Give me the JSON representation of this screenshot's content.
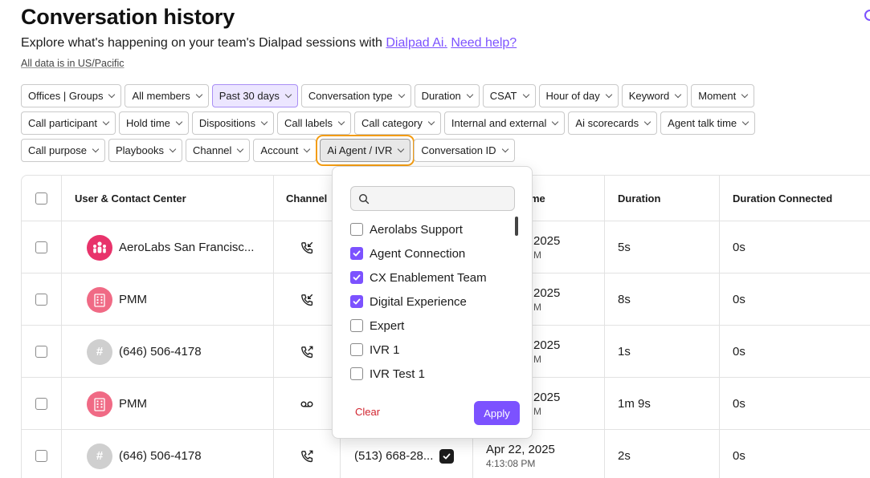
{
  "page": {
    "title": "Conversation history",
    "subtitle_text": "Explore what's happening on your team's Dialpad sessions with",
    "subtitle_link1": "Dialpad Ai.",
    "subtitle_link2": "Need help?",
    "timezone_note": "All data is in US/Pacific"
  },
  "filters": {
    "row1": [
      "Offices | Groups",
      "All members",
      "Past 30 days",
      "Conversation type",
      "Duration",
      "CSAT",
      "Hour of day",
      "Keyword",
      "Moment"
    ],
    "row2": [
      "Call participant",
      "Hold time",
      "Dispositions",
      "Call labels",
      "Call category",
      "Internal and external",
      "Ai scorecards",
      "Agent talk time"
    ],
    "row3": [
      "Call purpose",
      "Playbooks",
      "Channel",
      "Account",
      "Ai Agent / IVR",
      "Conversation ID"
    ],
    "active": "Past 30 days",
    "open": "Ai Agent / IVR"
  },
  "table": {
    "columns": {
      "user": "User & Contact Center",
      "channel": "Channel",
      "time": "me",
      "duration": "Duration",
      "duration_connected": "Duration Connected"
    },
    "rows": [
      {
        "name": "AeroLabs San Francisc...",
        "avatar": "team-icon",
        "channel_icon": "incoming-call-icon",
        "date": "2025",
        "time": "M",
        "duration": "5s",
        "connected": "0s"
      },
      {
        "name": "PMM",
        "avatar": "building-icon",
        "channel_icon": "incoming-call-icon",
        "date": "2025",
        "time": "M",
        "duration": "8s",
        "connected": "0s"
      },
      {
        "name": "(646) 506-4178",
        "avatar": "hash-icon",
        "channel_icon": "outgoing-call-icon",
        "date": "2025",
        "time": "M",
        "duration": "1s",
        "connected": "0s"
      },
      {
        "name": "PMM",
        "avatar": "building-icon",
        "channel_icon": "voicemail-icon",
        "date": "2025",
        "time": "M",
        "duration": "1m 9s",
        "connected": "0s"
      },
      {
        "name": "(646) 506-4178",
        "avatar": "hash-icon",
        "channel_icon": "outgoing-call-icon",
        "contact": "(513) 668-28...",
        "date": "Apr 22, 2025",
        "time": "4:13:08 PM",
        "duration": "2s",
        "connected": "0s"
      }
    ]
  },
  "dropdown": {
    "search_placeholder": "",
    "items": [
      {
        "label": "Aerolabs Support",
        "checked": false
      },
      {
        "label": "Agent Connection",
        "checked": true
      },
      {
        "label": "CX Enablement Team",
        "checked": true
      },
      {
        "label": "Digital Experience",
        "checked": true
      },
      {
        "label": "Expert",
        "checked": false
      },
      {
        "label": "IVR 1",
        "checked": false
      },
      {
        "label": "IVR Test 1",
        "checked": false
      }
    ],
    "clear_label": "Clear",
    "apply_label": "Apply"
  },
  "colors": {
    "accent": "#7c52ff",
    "highlight_outline": "#f39c12",
    "clear_text": "#d1242f"
  }
}
